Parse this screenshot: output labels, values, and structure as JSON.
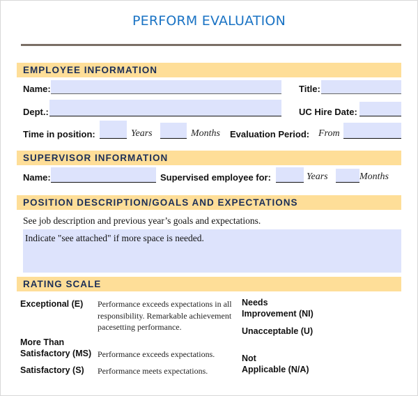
{
  "document": {
    "title": "PERFORM EVALUATION"
  },
  "colors": {
    "title": "#1a73c4",
    "section_band": "#fede98",
    "section_text": "#1c2f57",
    "field_fill": "#dde3fc",
    "rule": "#7a6f66"
  },
  "employee_info": {
    "heading": "EMPLOYEE INFORMATION",
    "name_label": "Name:",
    "name_value": "",
    "title_label": "Title:",
    "title_value": "",
    "dept_label": "Dept.:",
    "dept_value": "",
    "hire_date_label": "UC Hire Date:",
    "hire_date_value": "",
    "time_in_position_label": "Time in position:",
    "years_value": "",
    "years_unit": "Years",
    "months_value": "",
    "months_unit": "Months",
    "evaluation_period_label": "Evaluation Period:",
    "from_label": "From",
    "from_value": ""
  },
  "supervisor_info": {
    "heading": "SUPERVISOR INFORMATION",
    "name_label": "Name:",
    "name_value": "",
    "supervised_label": "Supervised employee for:",
    "years_value": "",
    "years_unit": "Years",
    "months_value": "",
    "months_unit": "Months"
  },
  "position": {
    "heading": "POSITION DESCRIPTION/GOALS AND EXPECTATIONS",
    "instruction": "See job description and previous year’s goals and expectations.",
    "textarea_value": "Indicate \"see attached\" if more space is needed."
  },
  "rating_scale": {
    "heading": "RATING SCALE",
    "left": [
      {
        "label": "Exceptional (E)",
        "description": "Performance exceeds expectations in all responsibility. Remarkable achievement pacesetting performance."
      },
      {
        "label_line1": "More Than",
        "label_line2": "Satisfactory (MS)",
        "description": "Performance exceeds expectations."
      },
      {
        "label": "Satisfactory (S)",
        "description": "Performance meets expectations."
      }
    ],
    "right": [
      {
        "label_line1": "Needs",
        "label_line2": "Improvement (NI)"
      },
      {
        "label": "Unacceptable (U)"
      },
      {
        "label_line1": "Not",
        "label_line2": "Applicable (N/A)"
      }
    ]
  }
}
